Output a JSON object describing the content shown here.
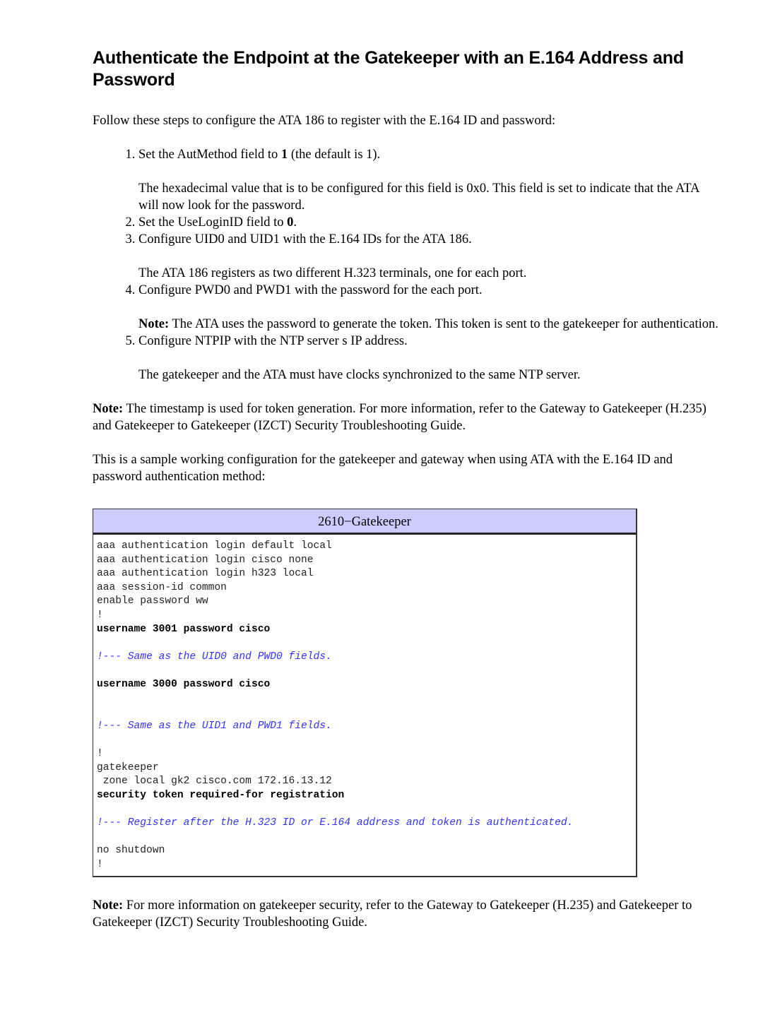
{
  "title": "Authenticate the Endpoint at the Gatekeeper with an E.164 Address and Password",
  "intro": "Follow these steps to configure the ATA 186 to register with the E.164 ID and password:",
  "steps": [
    {
      "pre": "Set the AutMethod field to ",
      "bold": "1",
      "post": " (the default is 1).",
      "sub_note_label": "",
      "sub": "The hexadecimal value that is to be configured for this field is 0x0. This field is set to indicate that the ATA will now look for the password."
    },
    {
      "pre": "Set the UseLoginID field to ",
      "bold": "0",
      "post": ".",
      "sub_note_label": "",
      "sub": ""
    },
    {
      "pre": "Configure UID0 and UID1 with the E.164 IDs for the ATA 186.",
      "bold": "",
      "post": "",
      "sub_note_label": "",
      "sub": "The ATA 186 registers as two different H.323 terminals, one for each port."
    },
    {
      "pre": "Configure PWD0 and PWD1 with the password for the each port.",
      "bold": "",
      "post": "",
      "sub_note_label": "Note:",
      "sub": " The ATA uses the password to generate the token. This token is sent to the gatekeeper for authentication."
    },
    {
      "pre": "Configure NTPIP with the NTP server s IP address.",
      "bold": "",
      "post": "",
      "sub_note_label": "",
      "sub": "The gatekeeper and the ATA must have clocks synchronized to the same NTP server."
    }
  ],
  "note1": {
    "label": "Note:",
    "text": " The timestamp is used for token generation. For more information, refer to the Gateway to Gatekeeper (H.235) and Gatekeeper to Gatekeeper (IZCT) Security Troubleshooting Guide."
  },
  "sample_intro": "This is a sample working configuration for the gatekeeper and gateway when using ATA with the E.164 ID and password authentication method:",
  "config": {
    "header": "2610−Gatekeeper",
    "header_color": "#ccccff",
    "comment_color": "#3333ff",
    "lines": [
      {
        "t": "aaa authentication login default local",
        "k": "n"
      },
      {
        "t": "aaa authentication login cisco none",
        "k": "n"
      },
      {
        "t": "aaa authentication login h323 local",
        "k": "n"
      },
      {
        "t": "aaa session-id common",
        "k": "n"
      },
      {
        "t": "enable password ww",
        "k": "n"
      },
      {
        "t": "!",
        "k": "n"
      },
      {
        "t": "username 3001 password cisco",
        "k": "b"
      },
      {
        "t": "",
        "k": "blank"
      },
      {
        "t": "!--- Same as the UID0 and PWD0 fields.",
        "k": "c"
      },
      {
        "t": "",
        "k": "blank"
      },
      {
        "t": "username 3000 password cisco",
        "k": "b"
      },
      {
        "t": "",
        "k": "blank"
      },
      {
        "t": "",
        "k": "blank"
      },
      {
        "t": "!--- Same as the UID1 and PWD1 fields.",
        "k": "c"
      },
      {
        "t": "",
        "k": "blank"
      },
      {
        "t": "!",
        "k": "n"
      },
      {
        "t": "gatekeeper",
        "k": "n"
      },
      {
        "t": " zone local gk2 cisco.com 172.16.13.12",
        "k": "n"
      },
      {
        "t": "security token required-for registration",
        "k": "b"
      },
      {
        "t": "",
        "k": "blank"
      },
      {
        "t": "!--- Register after the H.323 ID or E.164 address and token is authenticated.",
        "k": "c"
      },
      {
        "t": "",
        "k": "blank"
      },
      {
        "t": "no shutdown",
        "k": "n"
      },
      {
        "t": "!",
        "k": "n"
      }
    ]
  },
  "note2": {
    "label": "Note:",
    "text": " For more information on gatekeeper security, refer to the Gateway to Gatekeeper (H.235) and Gatekeeper to Gatekeeper (IZCT) Security Troubleshooting Guide."
  }
}
